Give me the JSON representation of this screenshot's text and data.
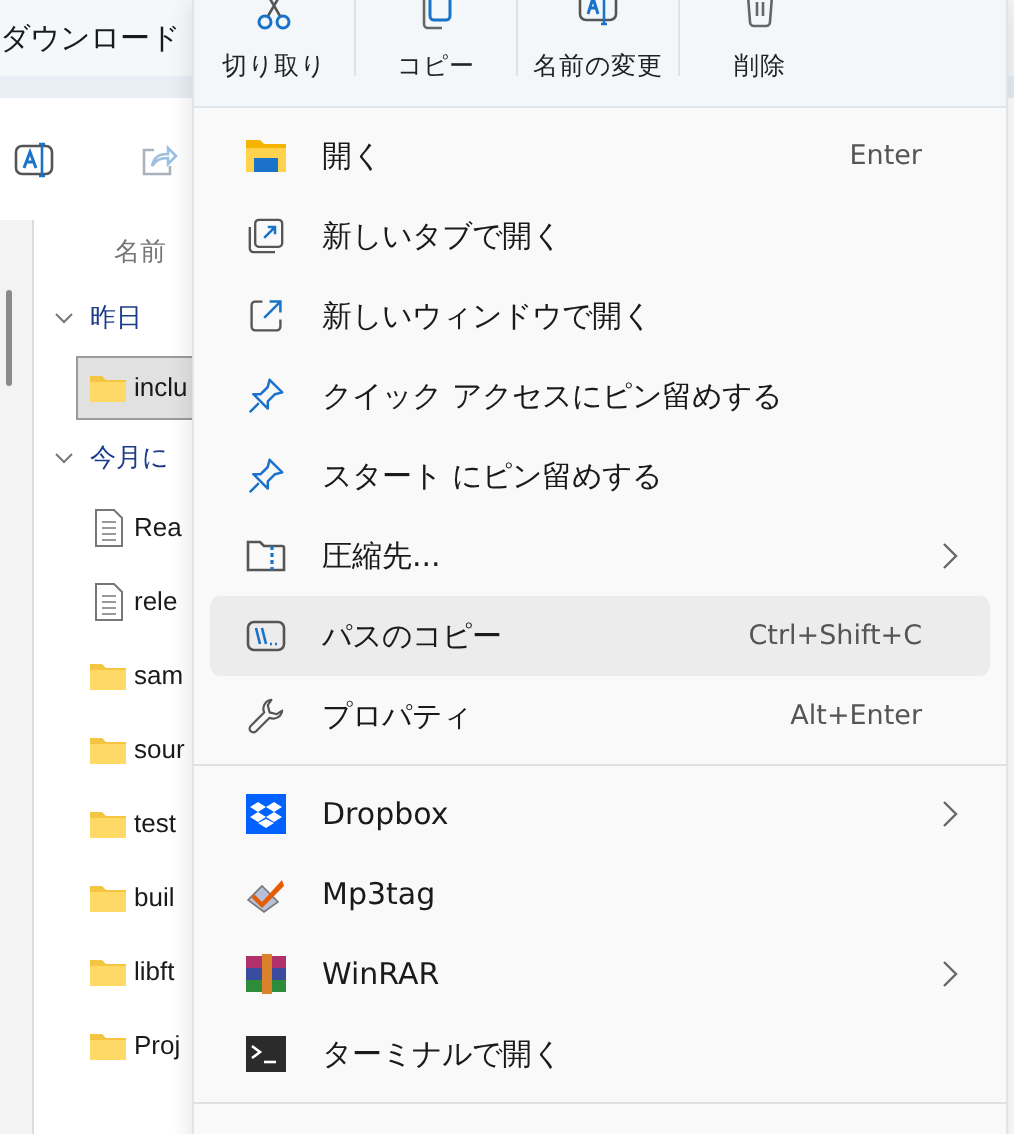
{
  "window": {
    "title": "ダウンロード"
  },
  "explorer": {
    "column_header": "名前",
    "groups": [
      {
        "label": "昨日",
        "expanded": true,
        "items": [
          {
            "name": "inclu",
            "kind": "folder",
            "selected": true
          }
        ]
      },
      {
        "label": "今月に",
        "expanded": true,
        "items": [
          {
            "name": "Rea",
            "kind": "file",
            "selected": false
          },
          {
            "name": "rele",
            "kind": "file",
            "selected": false
          },
          {
            "name": "sam",
            "kind": "folder",
            "selected": false
          },
          {
            "name": "sour",
            "kind": "folder",
            "selected": false
          },
          {
            "name": "test",
            "kind": "folder",
            "selected": false
          },
          {
            "name": "buil",
            "kind": "folder",
            "selected": false
          },
          {
            "name": "libft",
            "kind": "folder",
            "selected": false
          },
          {
            "name": "Proj",
            "kind": "folder",
            "selected": false
          }
        ]
      }
    ]
  },
  "context_menu": {
    "commands": [
      "切り取り",
      "コピー",
      "名前の変更",
      "削除"
    ],
    "sections": [
      {
        "items": [
          {
            "label": "開く",
            "shortcut": "Enter",
            "submenu": false,
            "selected": false
          },
          {
            "label": "新しいタブで開く",
            "submenu": false,
            "selected": false
          },
          {
            "label": "新しいウィンドウで開く",
            "submenu": false,
            "selected": false
          },
          {
            "label": "クイック アクセスにピン留めする",
            "submenu": false,
            "selected": false
          },
          {
            "label": "スタート にピン留めする",
            "submenu": false,
            "selected": false
          },
          {
            "label": "圧縮先...",
            "submenu": true,
            "selected": false
          },
          {
            "label": "パスのコピー",
            "shortcut": "Ctrl+Shift+C",
            "submenu": false,
            "selected": true
          },
          {
            "label": "プロパティ",
            "shortcut": "Alt+Enter",
            "submenu": false,
            "selected": false
          }
        ]
      },
      {
        "items": [
          {
            "label": "Dropbox",
            "submenu": true,
            "selected": false
          },
          {
            "label": "Mp3tag",
            "submenu": false,
            "selected": false
          },
          {
            "label": "WinRAR",
            "submenu": true,
            "selected": false
          },
          {
            "label": "ターミナルで開く",
            "submenu": false,
            "selected": false
          }
        ]
      }
    ]
  }
}
